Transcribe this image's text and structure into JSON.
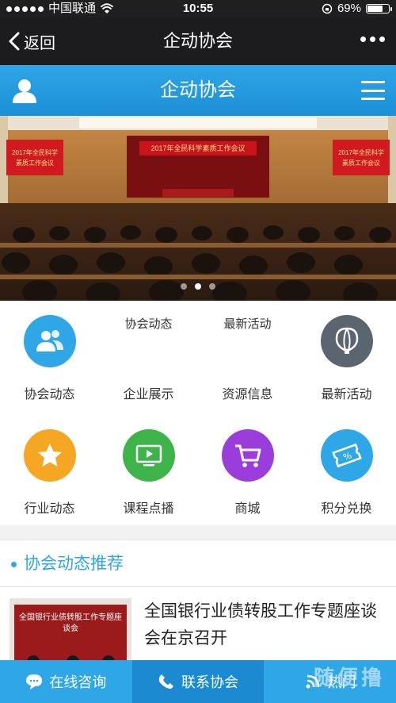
{
  "status_bar": {
    "carrier": "中国联通",
    "time": "10:55",
    "battery": "69%",
    "battery_level": 0.69
  },
  "nav_bar": {
    "back_label": "返回",
    "title": "企动协会",
    "more_icon": "more-dots-icon"
  },
  "app_header": {
    "title": "企动协会",
    "user_icon": "user-icon",
    "menu_icon": "hamburger-menu-icon"
  },
  "banner": {
    "screen_text": "2017年全民科学素质工作会议",
    "side_text_left": "2017年全民科学素质工作会议",
    "side_text_right": "2017年全民科学素质工作会议",
    "dots_count": 3,
    "active_dot": 1
  },
  "grid": {
    "overlay_texts": [
      "协会动态",
      "最新活动"
    ],
    "items": [
      {
        "label": "协会动态",
        "icon": "people-icon",
        "color": "#2fa6e6"
      },
      {
        "label": "企业展示",
        "icon": "blank",
        "color": ""
      },
      {
        "label": "资源信息",
        "icon": "blank",
        "color": ""
      },
      {
        "label": "最新活动",
        "icon": "balloon-icon",
        "color": "#5b6570"
      },
      {
        "label": "行业动态",
        "icon": "star-icon",
        "color": "#f5a623"
      },
      {
        "label": "课程点播",
        "icon": "video-play-icon",
        "color": "#3db34a"
      },
      {
        "label": "商城",
        "icon": "cart-icon",
        "color": "#9b3ddb"
      },
      {
        "label": "积分兑换",
        "icon": "ticket-icon",
        "color": "#2fa6e6"
      }
    ]
  },
  "section": {
    "title": "协会动态推荐",
    "accent_color": "#2fa6e6"
  },
  "news": {
    "title": "全国银行业债转股工作专题座谈会在京召开",
    "thumb_text": "全国银行业债转股工作专题座谈会"
  },
  "bottom_bar": {
    "consult_label": "在线咨询",
    "contact_label": "联系协会",
    "third_label": "热门"
  },
  "watermark": "随便撸"
}
